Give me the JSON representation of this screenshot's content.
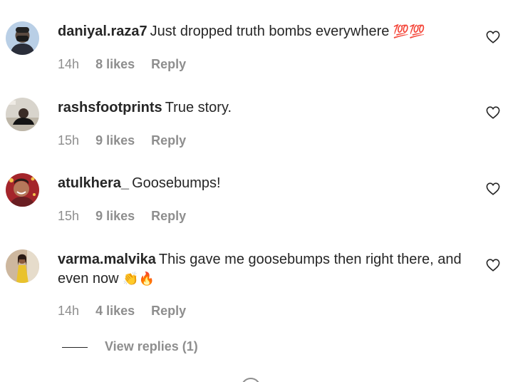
{
  "comments": [
    {
      "username": "daniyal.raza7",
      "text": "Just dropped truth bombs everywhere ",
      "emoji": "💯💯",
      "time": "14h",
      "likes": "8 likes",
      "reply": "Reply",
      "avatar_icon": "person-with-mask-avatar"
    },
    {
      "username": "rashsfootprints",
      "text": "True story.",
      "emoji": "",
      "time": "15h",
      "likes": "9 likes",
      "reply": "Reply",
      "avatar_icon": "person-on-ground-avatar"
    },
    {
      "username": "atulkhera_",
      "text": "Goosebumps!",
      "emoji": "",
      "time": "15h",
      "likes": "9 likes",
      "reply": "Reply",
      "avatar_icon": "smiling-person-avatar"
    },
    {
      "username": "varma.malvika",
      "text": "This gave me goosebumps then right there, and even now ",
      "emoji": "👏🔥",
      "time": "14h",
      "likes": "4 likes",
      "reply": "Reply",
      "avatar_icon": "person-yellow-dress-avatar"
    }
  ],
  "view_replies": "View replies (1)",
  "colors": {
    "text": "#262626",
    "muted": "#8e8e8e",
    "background": "#ffffff"
  }
}
